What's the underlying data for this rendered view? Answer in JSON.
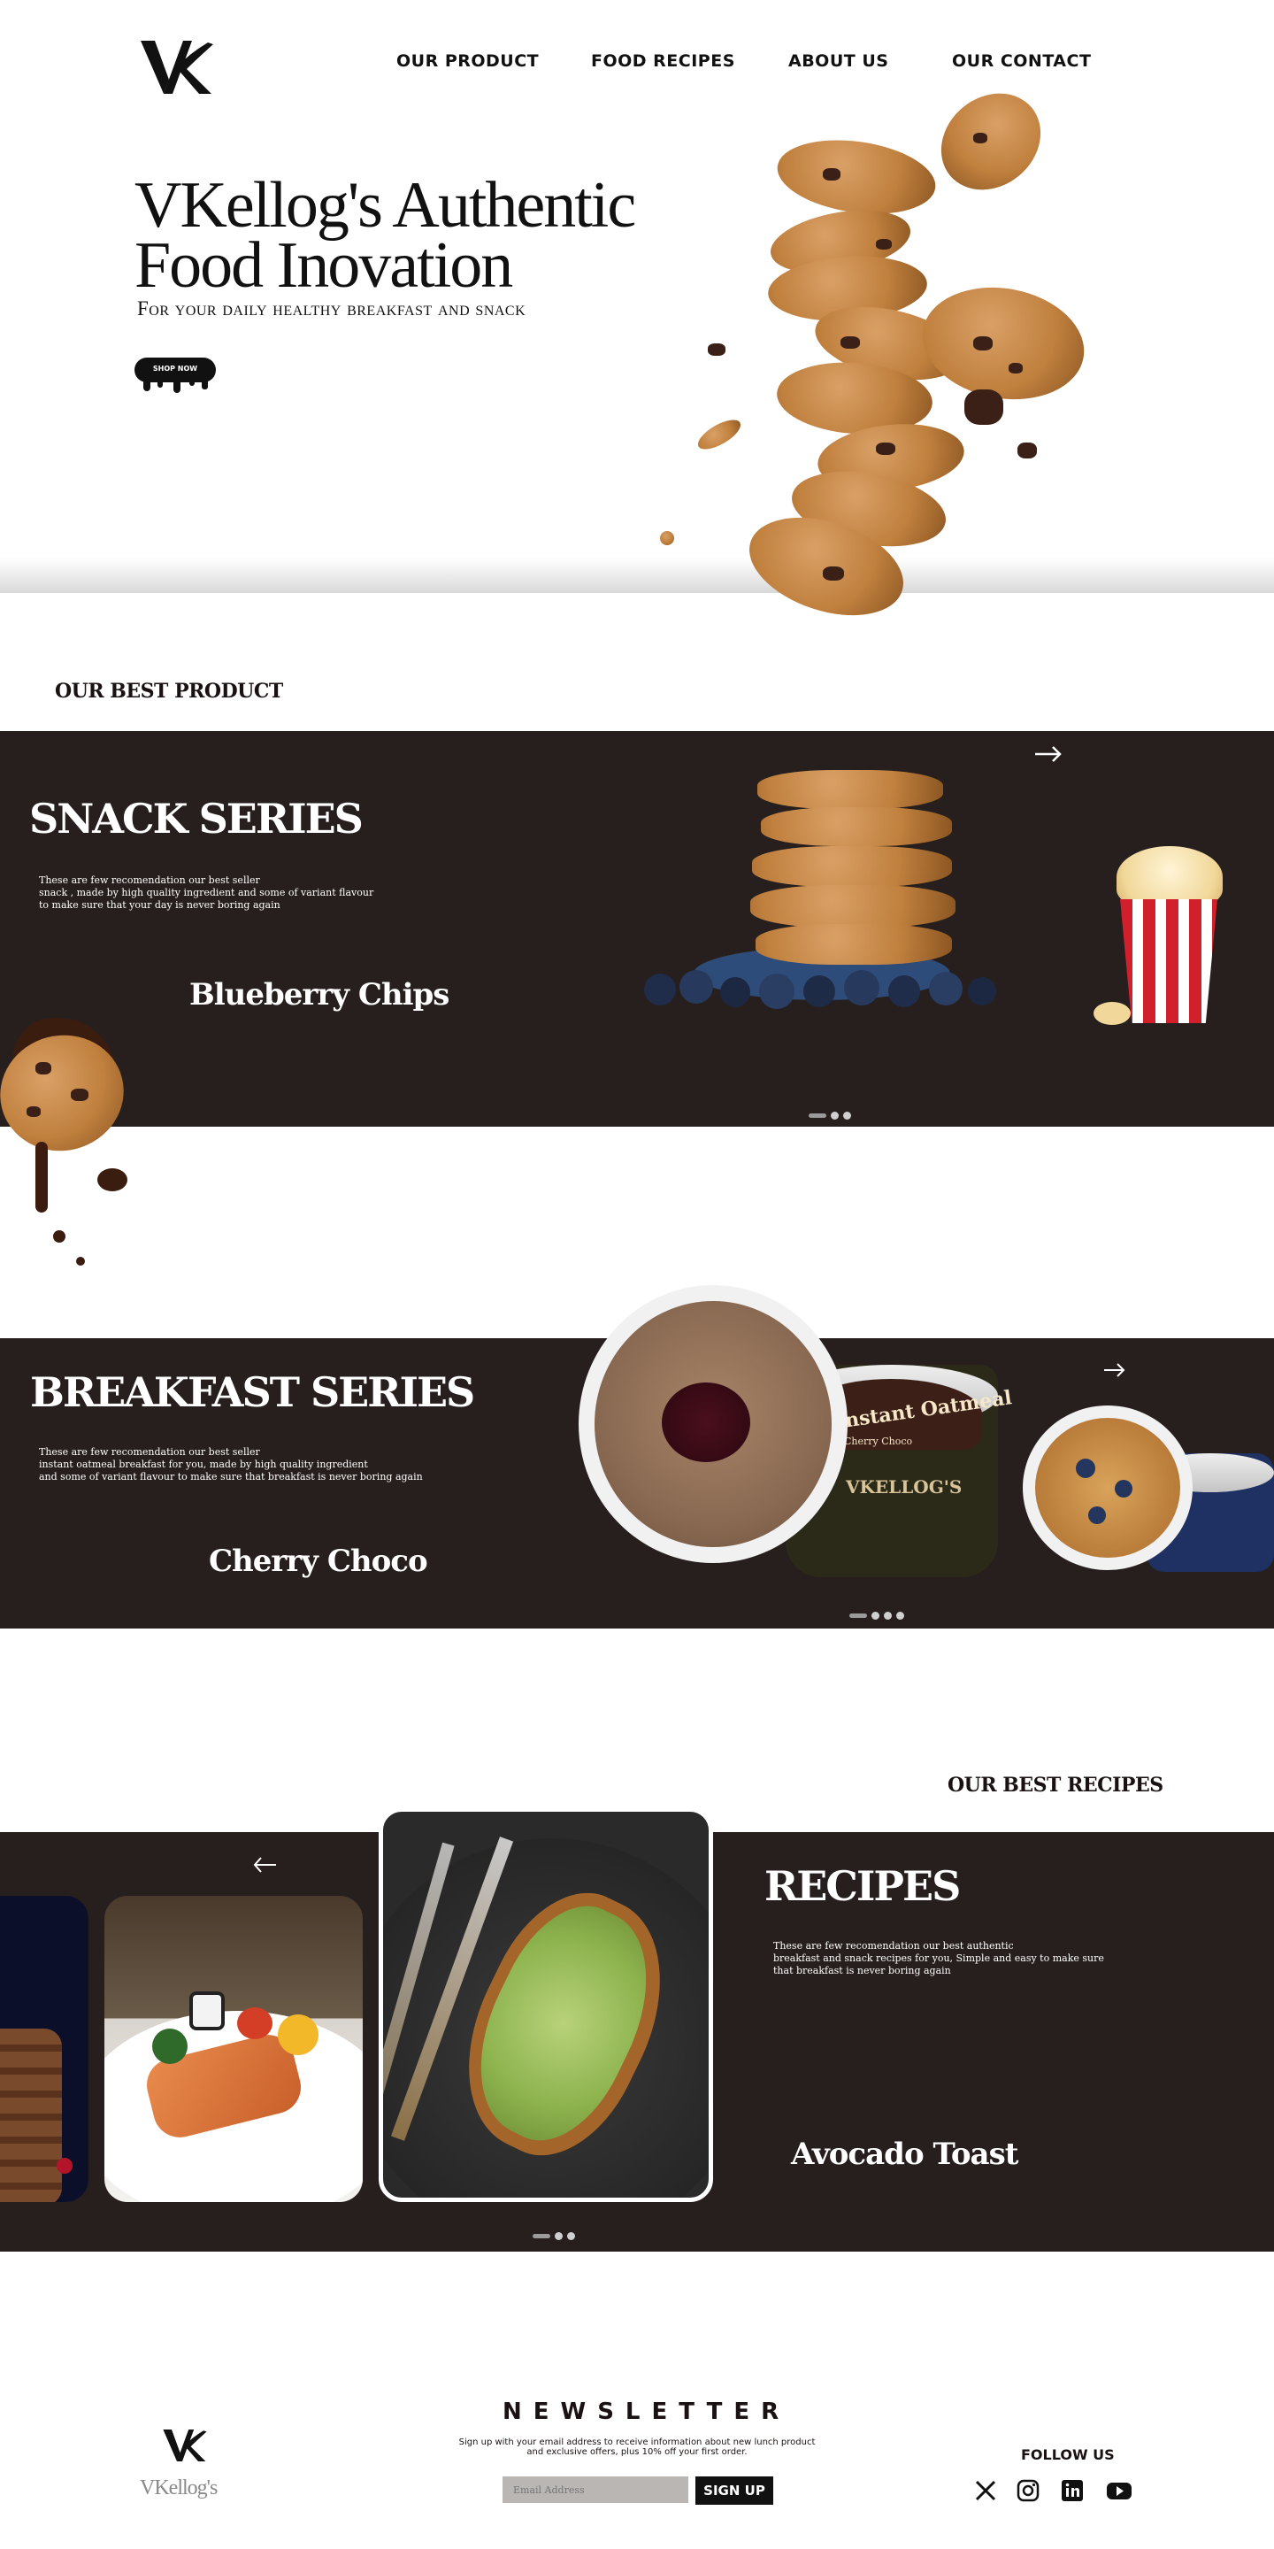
{
  "brand": {
    "logo_text": "VK",
    "name": "VKellog's"
  },
  "nav": {
    "items": [
      "OUR PRODUCT",
      "FOOD RECIPES",
      "ABOUT US",
      "OUR CONTACT"
    ]
  },
  "hero": {
    "title_line1": "VKellog's Authentic",
    "title_line2": "Food Inovation",
    "subtitle": "For your daily healthy breakfast and snack",
    "cta": "SHOP NOW"
  },
  "best_product": {
    "heading": "OUR BEST PRODUCT"
  },
  "snack": {
    "title": "SNACK SERIES",
    "desc_line1": "These are few recomendation our best seller",
    "desc_line2": "snack , made by high quality ingredient and some of variant flavour",
    "desc_line3": "to make sure that your day is never  boring again",
    "product_name": "Blueberry Chips"
  },
  "breakfast": {
    "title": "BREAKFAST SERIES",
    "desc_line1": "These are few recomendation our best seller",
    "desc_line2": "instant oatmeal breakfast for you, made by high quality ingredient",
    "desc_line3": "and some of variant flavour to make sure that breakfast is never  boring again",
    "product_name": "Cherry Choco",
    "package_label_1": "Instant Oatmeal",
    "package_label_2": "Cherry Choco",
    "package_brand": "VKELLOG'S"
  },
  "recipes": {
    "section_heading": "OUR BEST RECIPES",
    "title": "RECIPES",
    "desc_line1": "These are few recomendation our best authentic",
    "desc_line2": "breakfast and snack recipes for you, Simple and easy to make sure",
    "desc_line3": "that breakfast is never  boring again",
    "featured_name": "Avocado Toast"
  },
  "newsletter": {
    "title": "NEWSLETTER",
    "desc_line1": "Sign up with your email address to receive information about new lunch product",
    "desc_line2": "and exclusive offers, plus 10% off your first order.",
    "placeholder": "Email Address",
    "button": "SIGN UP"
  },
  "footer": {
    "follow_label": "FOLLOW US",
    "social_icons": [
      "x-icon",
      "instagram-icon",
      "linkedin-icon",
      "youtube-icon"
    ]
  },
  "colors": {
    "dark_band": "#271f1d",
    "text": "#1a1212",
    "white": "#ffffff"
  }
}
